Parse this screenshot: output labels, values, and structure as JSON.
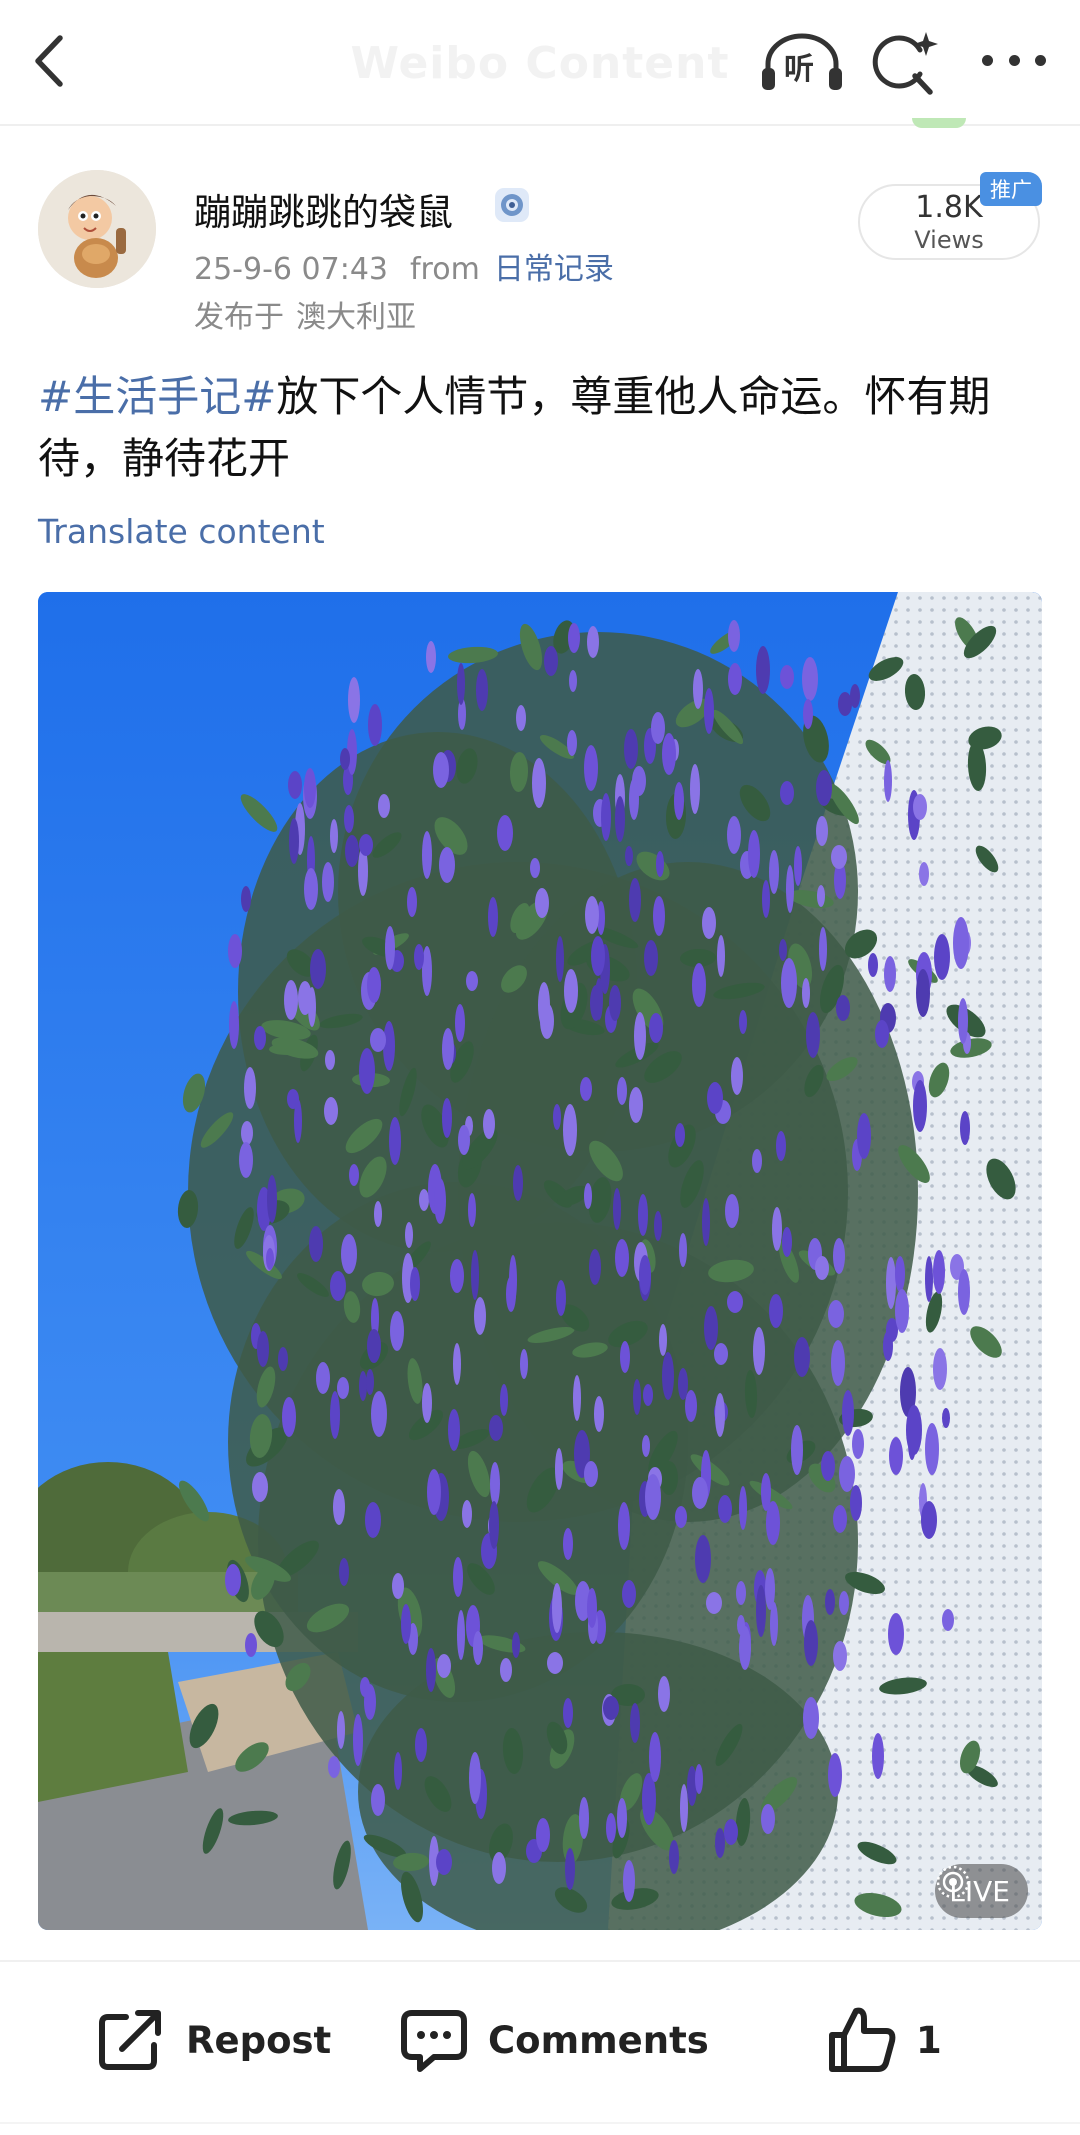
{
  "nav": {
    "title": "Weibo Content",
    "listen_label": "听"
  },
  "author": {
    "name": "蹦蹦跳跳的袋鼠",
    "time": "25-9-6 07:43",
    "from_label": "from",
    "source": "日常记录",
    "published_prefix": "发布于",
    "location": "澳大利亚"
  },
  "views": {
    "count": "1.8K",
    "label": "Views",
    "promo_badge": "推广"
  },
  "post": {
    "hashtag": "#生活手记#",
    "text": "放下个人情节，尊重他人命运。怀有期待，静待花开",
    "translate_label": "Translate content"
  },
  "media": {
    "live_label": "LIVE"
  },
  "actions": {
    "repost_label": "Repost",
    "comments_label": "Comments",
    "like_count": "1"
  },
  "colors": {
    "link": "#4a6ea8",
    "sky": "#2b7bf0",
    "flowers": "#6a4fd0"
  },
  "icons": [
    "back-icon",
    "headphones-icon",
    "search-sparkle-icon",
    "more-icon",
    "verified-icon",
    "live-icon",
    "repost-icon",
    "comment-icon",
    "thumbs-up-icon"
  ]
}
